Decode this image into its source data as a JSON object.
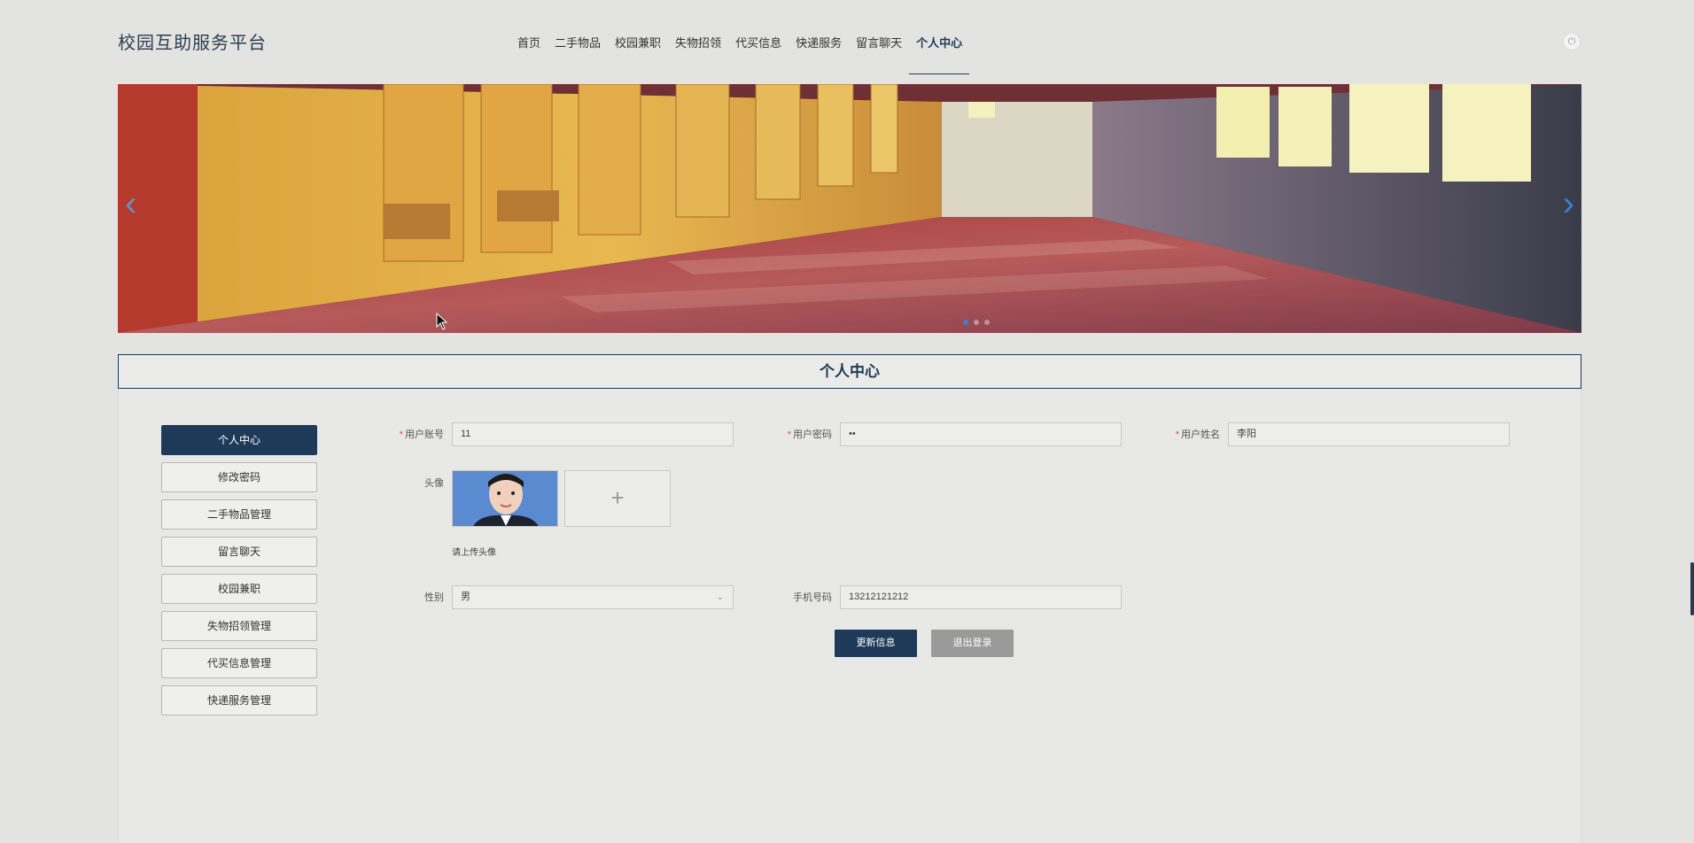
{
  "header": {
    "site_title": "校园互助服务平台",
    "nav": [
      {
        "label": "首页"
      },
      {
        "label": "二手物品"
      },
      {
        "label": "校园兼职"
      },
      {
        "label": "失物招领"
      },
      {
        "label": "代买信息"
      },
      {
        "label": "快递服务"
      },
      {
        "label": "留言聊天"
      },
      {
        "label": "个人中心",
        "active": true
      }
    ],
    "power_icon": "power-icon"
  },
  "banner": {
    "prev_glyph": "‹",
    "next_glyph": "›",
    "slides_count": 3,
    "active_slide": 1
  },
  "section": {
    "title": "个人中心"
  },
  "side_menu": [
    {
      "label": "个人中心",
      "active": true
    },
    {
      "label": "修改密码"
    },
    {
      "label": "二手物品管理"
    },
    {
      "label": "留言聊天"
    },
    {
      "label": "校园兼职"
    },
    {
      "label": "失物招领管理"
    },
    {
      "label": "代买信息管理"
    },
    {
      "label": "快递服务管理"
    }
  ],
  "form": {
    "account_label": "用户账号",
    "account_value": "11",
    "password_label": "用户密码",
    "password_value": "••",
    "name_label": "用户姓名",
    "name_value": "李阳",
    "avatar_label": "头像",
    "upload_glyph": "+",
    "upload_hint": "请上传头像",
    "gender_label": "性别",
    "gender_value": "男",
    "phone_label": "手机号码",
    "phone_value": "13212121212",
    "required_mark": "*"
  },
  "buttons": {
    "update": "更新信息",
    "logout": "退出登录"
  },
  "colors": {
    "primary": "#1e3a58",
    "background": "#e3e3e1",
    "secondary_button": "#9a9a9a"
  }
}
